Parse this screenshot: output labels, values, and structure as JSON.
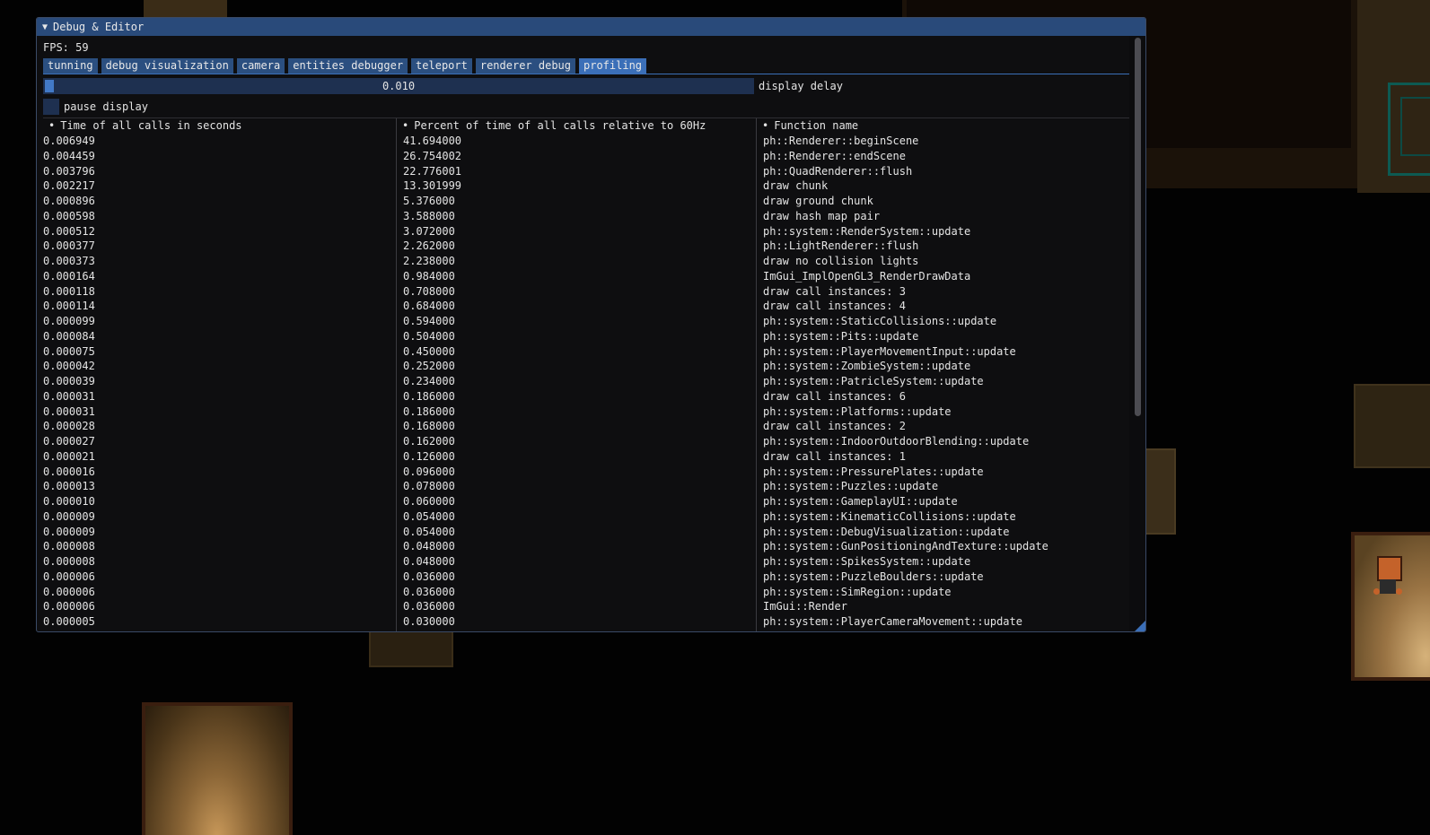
{
  "window": {
    "title": "Debug & Editor",
    "collapse_icon": "triangle-down-icon"
  },
  "fps_label": "FPS: 59",
  "tabs": [
    {
      "label": "tunning"
    },
    {
      "label": "debug visualization"
    },
    {
      "label": "camera"
    },
    {
      "label": "entities debugger"
    },
    {
      "label": "teleport"
    },
    {
      "label": "renderer debug"
    },
    {
      "label": "profiling",
      "active": true
    }
  ],
  "display_delay": {
    "value": "0.010",
    "label": "display delay",
    "fraction": 0.01
  },
  "pause_display": {
    "label": "pause display",
    "checked": false
  },
  "table": {
    "headers": [
      "Time of all calls in seconds",
      "Percent of time of all calls relative to 60Hz",
      "Function name"
    ],
    "rows": [
      [
        "0.006949",
        "41.694000",
        "ph::Renderer::beginScene"
      ],
      [
        "0.004459",
        "26.754002",
        "ph::Renderer::endScene"
      ],
      [
        "0.003796",
        "22.776001",
        "ph::QuadRenderer::flush"
      ],
      [
        "0.002217",
        "13.301999",
        "draw chunk"
      ],
      [
        "0.000896",
        "5.376000",
        "draw ground chunk"
      ],
      [
        "0.000598",
        "3.588000",
        "draw hash map pair"
      ],
      [
        "0.000512",
        "3.072000",
        "ph::system::RenderSystem::update"
      ],
      [
        "0.000377",
        "2.262000",
        "ph::LightRenderer::flush"
      ],
      [
        "0.000373",
        "2.238000",
        "draw no collision lights"
      ],
      [
        "0.000164",
        "0.984000",
        "ImGui_ImplOpenGL3_RenderDrawData"
      ],
      [
        "0.000118",
        "0.708000",
        "draw call instances: 3"
      ],
      [
        "0.000114",
        "0.684000",
        "draw call instances: 4"
      ],
      [
        "0.000099",
        "0.594000",
        "ph::system::StaticCollisions::update"
      ],
      [
        "0.000084",
        "0.504000",
        "ph::system::Pits::update"
      ],
      [
        "0.000075",
        "0.450000",
        "ph::system::PlayerMovementInput::update"
      ],
      [
        "0.000042",
        "0.252000",
        "ph::system::ZombieSystem::update"
      ],
      [
        "0.000039",
        "0.234000",
        "ph::system::PatricleSystem::update"
      ],
      [
        "0.000031",
        "0.186000",
        "draw call instances: 6"
      ],
      [
        "0.000031",
        "0.186000",
        "ph::system::Platforms::update"
      ],
      [
        "0.000028",
        "0.168000",
        "draw call instances: 2"
      ],
      [
        "0.000027",
        "0.162000",
        "ph::system::IndoorOutdoorBlending::update"
      ],
      [
        "0.000021",
        "0.126000",
        "draw call instances: 1"
      ],
      [
        "0.000016",
        "0.096000",
        "ph::system::PressurePlates::update"
      ],
      [
        "0.000013",
        "0.078000",
        "ph::system::Puzzles::update"
      ],
      [
        "0.000010",
        "0.060000",
        "ph::system::GameplayUI::update"
      ],
      [
        "0.000009",
        "0.054000",
        "ph::system::KinematicCollisions::update"
      ],
      [
        "0.000009",
        "0.054000",
        "ph::system::DebugVisualization::update"
      ],
      [
        "0.000008",
        "0.048000",
        "ph::system::GunPositioningAndTexture::update"
      ],
      [
        "0.000008",
        "0.048000",
        "ph::system::SpikesSystem::update"
      ],
      [
        "0.000006",
        "0.036000",
        "ph::system::PuzzleBoulders::update"
      ],
      [
        "0.000006",
        "0.036000",
        "ph::system::SimRegion::update"
      ],
      [
        "0.000006",
        "0.036000",
        "ImGui::Render"
      ],
      [
        "0.000005",
        "0.030000",
        "ph::system::PlayerCameraMovement::update"
      ]
    ]
  },
  "colors": {
    "title_bar": "#294a7a",
    "tab": "#2b4f80",
    "tab_active": "#3b6fb8",
    "window_bg": "#0e0e10",
    "text": "#e4e4e4"
  }
}
